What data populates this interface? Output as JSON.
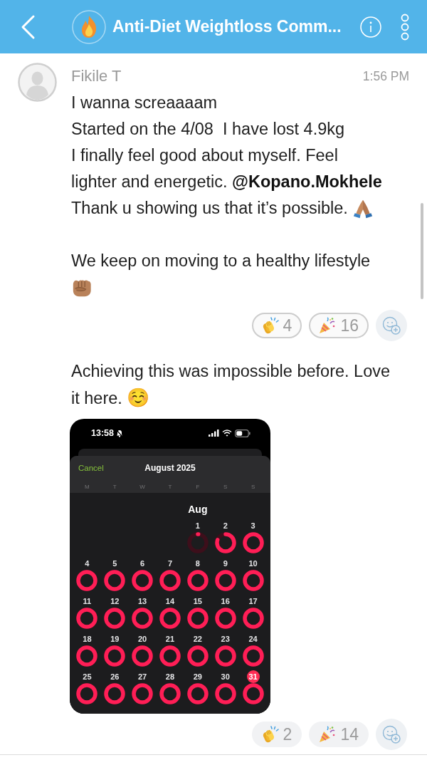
{
  "header": {
    "title": "Anti-Diet Weightloss Comm..."
  },
  "post": {
    "author": "Fikile T",
    "time": "1:56 PM",
    "messages": [
      {
        "paragraphs": [
          {
            "lines": [
              {
                "kind": "text",
                "text": "I wanna screaaaam\nStarted on the 4/08  I have lost 4.9kg\nI finally feel good about myself. Feel\nlighter and energetic. **@Kopano.Mokhele**"
              },
              {
                "kind": "text",
                "text": "Thank u showing us that it’s possible.",
                "emoji": {
                  "kind": "folded-hands"
                }
              }
            ]
          },
          {
            "lines": [
              {
                "kind": "text",
                "text": "We keep on moving to a healthy lifestyle"
              },
              {
                "kind": "emoji",
                "emoji": {
                  "kind": "fist"
                }
              }
            ]
          }
        ],
        "reactions": [
          {
            "kind": "clap",
            "count": "4",
            "selected": true
          },
          {
            "kind": "party",
            "count": "16",
            "selected": true
          }
        ]
      },
      {
        "paragraphs": [
          {
            "lines": [
              {
                "kind": "text",
                "text": "Achieving this was impossible before. Love\nit here. ☺️"
              }
            ]
          }
        ],
        "attachment": {
          "status_time": "13:58",
          "cancel": "Cancel",
          "title": "August 2025",
          "weekdays": [
            "M",
            "T",
            "W",
            "T",
            "F",
            "S",
            "S"
          ],
          "month": "Aug",
          "weeks": [
            {
              "days": [
                {
                  "label": "1",
                  "kind": "started",
                  "selected": false
                },
                {
                  "label": "2",
                  "kind": "partial",
                  "selected": false
                },
                {
                  "label": "3",
                  "kind": "closed",
                  "selected": false
                }
              ]
            },
            {
              "days": [
                {
                  "label": "4",
                  "kind": "closed",
                  "selected": false
                },
                {
                  "label": "5",
                  "kind": "closed",
                  "selected": false
                },
                {
                  "label": "6",
                  "kind": "closed",
                  "selected": false
                },
                {
                  "label": "7",
                  "kind": "closed",
                  "selected": false
                },
                {
                  "label": "8",
                  "kind": "closed",
                  "selected": false
                },
                {
                  "label": "9",
                  "kind": "closed",
                  "selected": false
                },
                {
                  "label": "10",
                  "kind": "closed",
                  "selected": false
                }
              ]
            },
            {
              "days": [
                {
                  "label": "11",
                  "kind": "closed",
                  "selected": false
                },
                {
                  "label": "12",
                  "kind": "closed",
                  "selected": false
                },
                {
                  "label": "13",
                  "kind": "closed",
                  "selected": false
                },
                {
                  "label": "14",
                  "kind": "closed",
                  "selected": false
                },
                {
                  "label": "15",
                  "kind": "closed",
                  "selected": false
                },
                {
                  "label": "16",
                  "kind": "closed",
                  "selected": false
                },
                {
                  "label": "17",
                  "kind": "closed",
                  "selected": false
                }
              ]
            },
            {
              "days": [
                {
                  "label": "18",
                  "kind": "closed",
                  "selected": false
                },
                {
                  "label": "19",
                  "kind": "closed",
                  "selected": false
                },
                {
                  "label": "20",
                  "kind": "closed",
                  "selected": false
                },
                {
                  "label": "21",
                  "kind": "closed",
                  "selected": false
                },
                {
                  "label": "22",
                  "kind": "closed",
                  "selected": false
                },
                {
                  "label": "23",
                  "kind": "closed",
                  "selected": false
                },
                {
                  "label": "24",
                  "kind": "closed",
                  "selected": false
                }
              ]
            },
            {
              "days": [
                {
                  "label": "25",
                  "kind": "closed",
                  "selected": false
                },
                {
                  "label": "26",
                  "kind": "closed",
                  "selected": false
                },
                {
                  "label": "27",
                  "kind": "closed",
                  "selected": false
                },
                {
                  "label": "28",
                  "kind": "closed",
                  "selected": false
                },
                {
                  "label": "29",
                  "kind": "closed",
                  "selected": false
                },
                {
                  "label": "30",
                  "kind": "closed",
                  "selected": false
                },
                {
                  "label": "31",
                  "kind": "closed",
                  "selected": true
                }
              ]
            }
          ]
        },
        "reactions": [
          {
            "kind": "clap",
            "count": "2",
            "selected": false
          },
          {
            "kind": "party",
            "count": "14",
            "selected": false
          }
        ]
      }
    ]
  }
}
